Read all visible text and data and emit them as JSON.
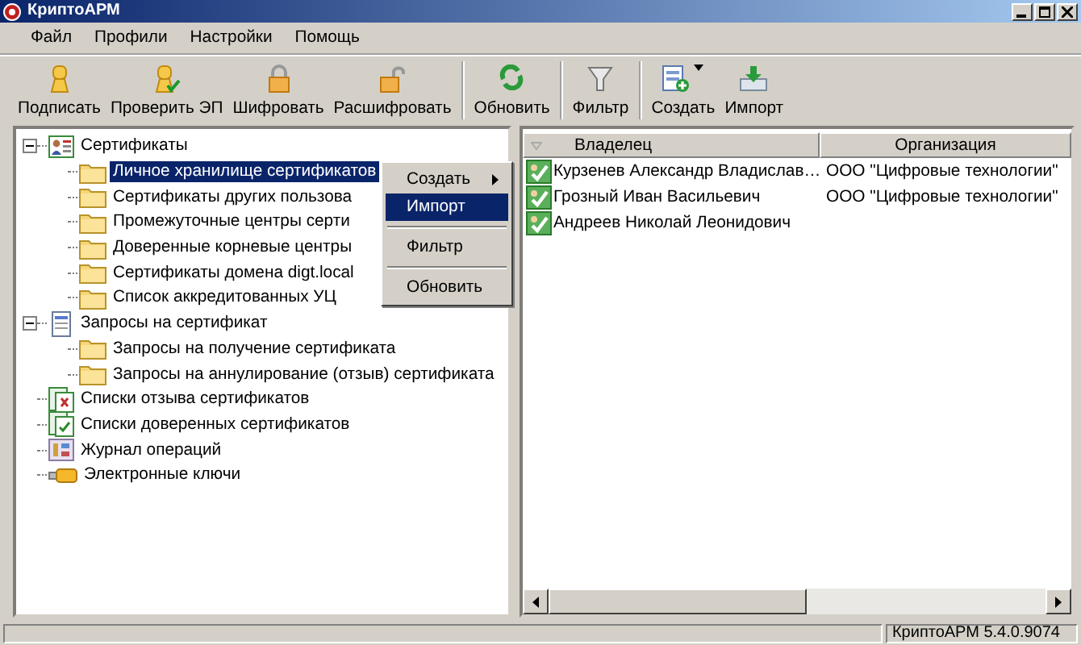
{
  "window": {
    "title": "КриптоАРМ"
  },
  "menu": [
    "Файл",
    "Профили",
    "Настройки",
    "Помощь"
  ],
  "toolbar": {
    "groups": [
      [
        {
          "label": "Подписать",
          "kind": "sign",
          "dropdown": false
        },
        {
          "label": "Проверить ЭП",
          "kind": "verify",
          "dropdown": false
        },
        {
          "label": "Шифровать",
          "kind": "lock",
          "dropdown": false
        },
        {
          "label": "Расшифровать",
          "kind": "unlock",
          "dropdown": false
        }
      ],
      [
        {
          "label": "Обновить",
          "kind": "refresh",
          "dropdown": false
        }
      ],
      [
        {
          "label": "Фильтр",
          "kind": "filter",
          "dropdown": false
        }
      ],
      [
        {
          "label": "Создать",
          "kind": "create",
          "dropdown": true
        },
        {
          "label": "Импорт",
          "kind": "import",
          "dropdown": false
        }
      ]
    ]
  },
  "tree": [
    {
      "label": "Сертификаты",
      "kind": "certs",
      "expanded": true,
      "selected": false,
      "children": [
        {
          "label": "Личное хранилище сертификатов",
          "kind": "folder",
          "selected": true
        },
        {
          "label": "Сертификаты других пользова",
          "kind": "folder",
          "selected": false
        },
        {
          "label": "Промежуточные центры серти",
          "kind": "folder",
          "selected": false
        },
        {
          "label": "Доверенные корневые центры",
          "kind": "folder",
          "selected": false
        },
        {
          "label": "Сертификаты домена digt.local",
          "kind": "folder",
          "selected": false
        },
        {
          "label": "Список аккредитованных УЦ",
          "kind": "folder",
          "selected": false
        }
      ]
    },
    {
      "label": "Запросы на сертификат",
      "kind": "requests",
      "expanded": true,
      "selected": false,
      "children": [
        {
          "label": "Запросы на получение сертификата",
          "kind": "folder",
          "selected": false
        },
        {
          "label": "Запросы на аннулирование (отзыв) сертификата",
          "kind": "folder",
          "selected": false
        }
      ]
    },
    {
      "label": "Списки отзыва сертификатов",
      "kind": "crl",
      "selected": false
    },
    {
      "label": "Списки доверенных сертификатов",
      "kind": "ctl",
      "selected": false
    },
    {
      "label": "Журнал операций",
      "kind": "log",
      "selected": false
    },
    {
      "label": "Электронные ключи",
      "kind": "key",
      "selected": false
    }
  ],
  "context_menu": [
    {
      "kind": "item",
      "label": "Создать",
      "submenu": true,
      "selected": false
    },
    {
      "kind": "item",
      "label": "Импорт",
      "submenu": false,
      "selected": true
    },
    {
      "kind": "separator"
    },
    {
      "kind": "item",
      "label": "Фильтр",
      "submenu": false,
      "selected": false
    },
    {
      "kind": "separator"
    },
    {
      "kind": "item",
      "label": "Обновить",
      "submenu": false,
      "selected": false
    }
  ],
  "table": {
    "columns": [
      {
        "label": "Владелец",
        "sorted": true
      },
      {
        "label": "Организация",
        "sorted": false
      }
    ],
    "rows": [
      {
        "owner": "Курзенев Александр Владислав…",
        "organization": "ООО \"Цифровые технологии\""
      },
      {
        "owner": "Грозный Иван Васильевич",
        "organization": "ООО \"Цифровые технологии\""
      },
      {
        "owner": "Андреев Николай Леонидович"
      }
    ]
  },
  "status_bar": {
    "version": "КриптоАРМ 5.4.0.9074"
  }
}
